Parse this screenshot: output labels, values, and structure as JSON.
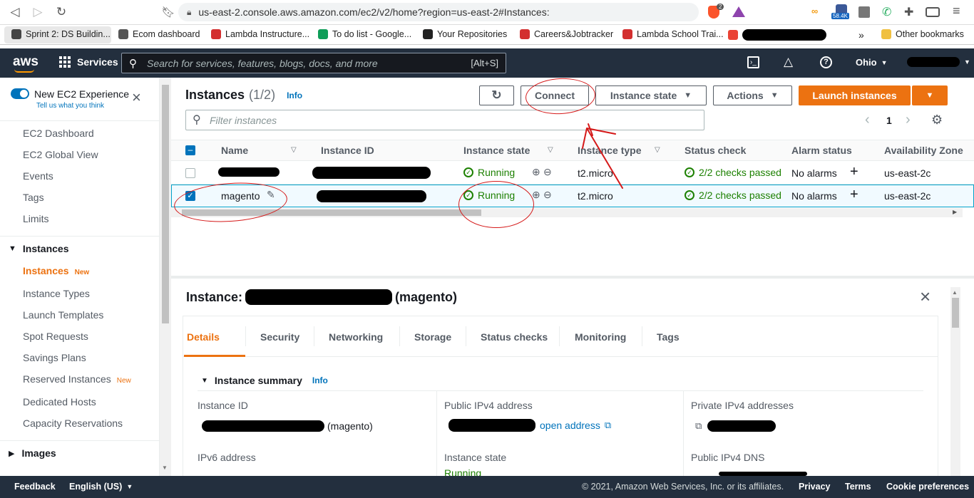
{
  "browser": {
    "url": "us-east-2.console.aws.amazon.com/ec2/v2/home?region=us-east-2#Instances:",
    "brave_badge": "2",
    "ext_count": "58.4K",
    "bookmarks": [
      {
        "label": "Sprint 2: DS Buildin...",
        "icon": "pencil-icon",
        "color": "#444"
      },
      {
        "label": "Ecom dashboard",
        "icon": "globe-icon",
        "color": "#555"
      },
      {
        "label": "Lambda Instructure...",
        "icon": "lambda-icon",
        "color": "#d32f2f"
      },
      {
        "label": "To do list - Google...",
        "icon": "sheets-icon",
        "color": "#0f9d58"
      },
      {
        "label": "Your Repositories",
        "icon": "github-icon",
        "color": "#222"
      },
      {
        "label": "Careers&Jobtracker",
        "icon": "lambda-icon",
        "color": "#d32f2f"
      },
      {
        "label": "Lambda School Trai...",
        "icon": "lambda-icon",
        "color": "#d32f2f"
      }
    ],
    "more": "»",
    "other_bookmarks": "Other bookmarks"
  },
  "aws_header": {
    "logo": "aws",
    "services": "Services",
    "search_placeholder": "Search for services, features, blogs, docs, and more",
    "shortcut": "[Alt+S]",
    "region": "Ohio"
  },
  "sidebar": {
    "new_experience": "New EC2 Experience",
    "tell_us": "Tell us what you think",
    "top_items": [
      "EC2 Dashboard",
      "EC2 Global View",
      "Events",
      "Tags",
      "Limits"
    ],
    "section_instances": "Instances",
    "instance_items": [
      "Instances",
      "Instance Types",
      "Launch Templates",
      "Spot Requests",
      "Savings Plans",
      "Reserved Instances",
      "Dedicated Hosts",
      "Capacity Reservations"
    ],
    "new_badge": "New",
    "section_images": "Images"
  },
  "instances_panel": {
    "title": "Instances",
    "count": "(1/2)",
    "info": "Info",
    "connect": "Connect",
    "instance_state": "Instance state",
    "actions": "Actions",
    "launch": "Launch instances",
    "filter_placeholder": "Filter instances",
    "page": "1",
    "columns": [
      "Name",
      "Instance ID",
      "Instance state",
      "Instance type",
      "Status check",
      "Alarm status",
      "Availability Zone"
    ],
    "rows": [
      {
        "name": "",
        "state": "Running",
        "type": "t2.micro",
        "status": "2/2 checks passed",
        "alarm": "No alarms",
        "zone": "us-east-2c",
        "checked": false
      },
      {
        "name": "magento",
        "state": "Running",
        "type": "t2.micro",
        "status": "2/2 checks passed",
        "alarm": "No alarms",
        "zone": "us-east-2c",
        "checked": true
      }
    ]
  },
  "detail_panel": {
    "title_prefix": "Instance:",
    "title_suffix": "(magento)",
    "tabs": [
      "Details",
      "Security",
      "Networking",
      "Storage",
      "Status checks",
      "Monitoring",
      "Tags"
    ],
    "summary": "Instance summary",
    "info": "Info",
    "fields": {
      "instance_id_label": "Instance ID",
      "instance_id_suffix": "(magento)",
      "public_ipv4_label": "Public IPv4 address",
      "open_address": "open address",
      "private_ipv4_label": "Private IPv4 addresses",
      "ipv6_label": "IPv6 address",
      "instance_state_label": "Instance state",
      "instance_state_value": "Running",
      "public_dns_label": "Public IPv4 DNS"
    }
  },
  "footer": {
    "feedback": "Feedback",
    "language": "English (US)",
    "copyright": "© 2021, Amazon Web Services, Inc. or its affiliates.",
    "privacy": "Privacy",
    "terms": "Terms",
    "cookies": "Cookie preferences"
  }
}
